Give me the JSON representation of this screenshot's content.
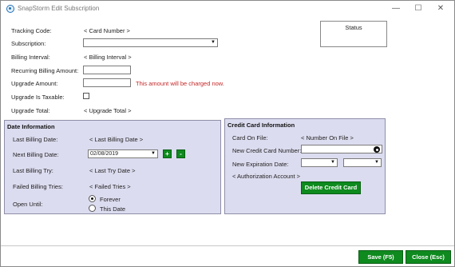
{
  "window": {
    "title": "SnapStorm Edit Subscription",
    "minimize": "—",
    "maximize": "☐",
    "close": "✕"
  },
  "form": {
    "tracking_code_label": "Tracking Code:",
    "tracking_code_value": "< Card Number >",
    "subscription_label": "Subscription:",
    "subscription_value": "",
    "billing_interval_label": "Billing Interval:",
    "billing_interval_value": "< Billing Interval >",
    "recurring_amount_label": "Recurring Billing Amount:",
    "recurring_amount_value": "",
    "upgrade_amount_label": "Upgrade Amount:",
    "upgrade_amount_value": "",
    "upgrade_warning": "This amount will be charged now.",
    "upgrade_taxable_label": "Upgrade Is Taxable:",
    "upgrade_total_label": "Upgrade Total:",
    "upgrade_total_value": "< Upgrade Total >"
  },
  "status": {
    "label": "Status"
  },
  "date_info": {
    "title": "Date Information",
    "last_billing_label": "Last Billing Date:",
    "last_billing_value": "< Last Billing Date >",
    "next_billing_label": "Next Billing Date:",
    "next_billing_value": "02/08/2019",
    "plus": "+",
    "minus": "-",
    "last_try_label": "Last Billing Try:",
    "last_try_value": "< Last Try Date >",
    "failed_tries_label": "Failed Billing Tries:",
    "failed_tries_value": "< Failed Tries >",
    "open_until_label": "Open Until:",
    "option_forever": "Forever",
    "option_this_date": "This Date",
    "selected": "Forever"
  },
  "credit_card": {
    "title": "Credit Card Information",
    "card_on_file_label": "Card On File:",
    "card_on_file_value": "< Number On File >",
    "new_card_label": "New Credit Card Number:",
    "new_card_value": "",
    "expiration_label": "New Expiration Date:",
    "exp_month": "",
    "exp_year": "",
    "authorization_account": "< Authorization Account >",
    "delete_button": "Delete Credit Card"
  },
  "footer": {
    "save_button": "Save (F5)",
    "close_button": "Close (Esc)"
  }
}
